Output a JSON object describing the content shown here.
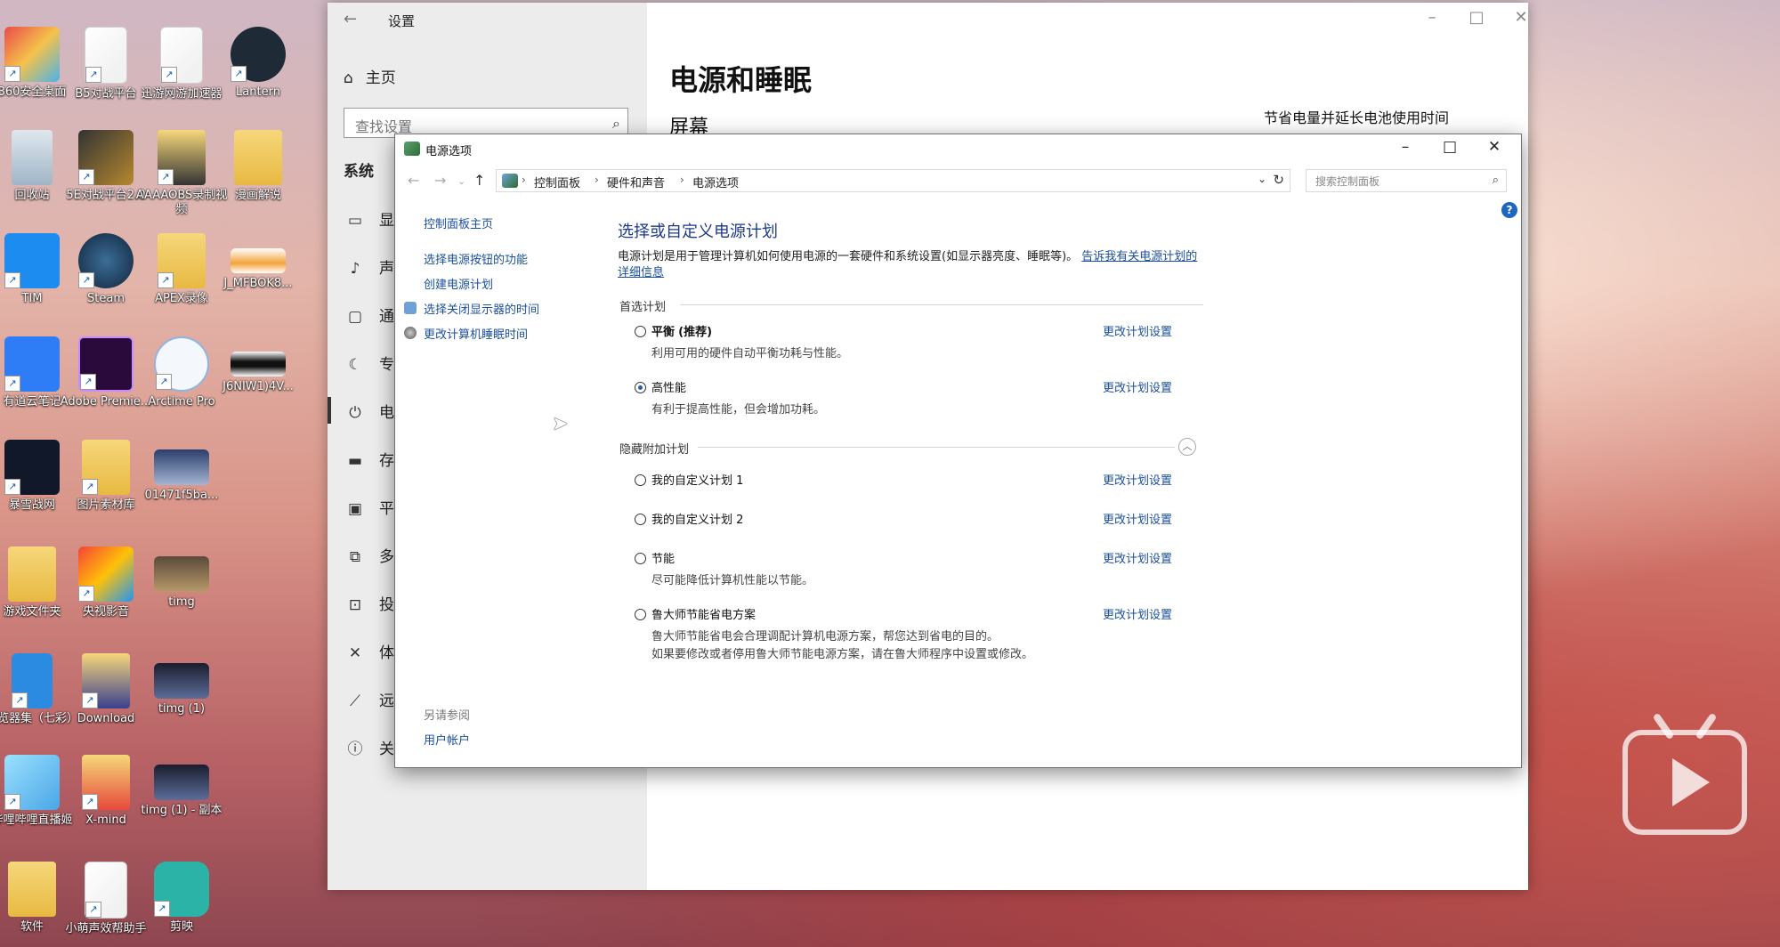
{
  "desktop": {
    "icons": [
      {
        "label": "360安全桌面"
      },
      {
        "label": "B5对战平台"
      },
      {
        "label": "迅游网游加速器"
      },
      {
        "label": "Lantern"
      },
      {
        "label": "回收站"
      },
      {
        "label": "5E对战平台2.0"
      },
      {
        "label": "AAAAOBS录制视频"
      },
      {
        "label": "漫画解说"
      },
      {
        "label": "TIM"
      },
      {
        "label": "Steam"
      },
      {
        "label": "APEX录像"
      },
      {
        "label": "J_MFBOK8..."
      },
      {
        "label": "有道云笔记"
      },
      {
        "label": "Adobe Premie..."
      },
      {
        "label": "Arctime Pro"
      },
      {
        "label": "J6NIW1)4V..."
      },
      {
        "label": "暴雪战网"
      },
      {
        "label": "图片素材库"
      },
      {
        "label": "01471f5ba..."
      },
      {
        "label": "游戏文件夹"
      },
      {
        "label": "央视影音"
      },
      {
        "label": "timg"
      },
      {
        "label": "浏览器集（七彩）"
      },
      {
        "label": "Download"
      },
      {
        "label": "timg (1)"
      },
      {
        "label": "哔哩哔哩直播姬"
      },
      {
        "label": "X-mind"
      },
      {
        "label": "timg (1) - 副本"
      },
      {
        "label": "软件"
      },
      {
        "label": "小萌声效帮助手"
      },
      {
        "label": "剪映"
      }
    ]
  },
  "settings": {
    "title": "设置",
    "home": "主页",
    "search_placeholder": "查找设置",
    "section": "系统",
    "side_items": [
      "显示",
      "声音",
      "通知",
      "专注",
      "电源",
      "存储",
      "平板",
      "多任务",
      "投影",
      "体验",
      "远程",
      "关于"
    ],
    "main_title": "电源和睡眠",
    "sub_title": "屏幕",
    "right_note": "节省电量并延长电池使用时间"
  },
  "power": {
    "title": "电源选项",
    "breadcrumb": [
      "控制面板",
      "硬件和声音",
      "电源选项"
    ],
    "search_placeholder": "搜索控制面板",
    "help": "?",
    "left_links": [
      "控制面板主页",
      "选择电源按钮的功能",
      "创建电源计划",
      "选择关闭显示器的时间",
      "更改计算机睡眠时间"
    ],
    "see_also_label": "另请参阅",
    "see_also_link": "用户帐户",
    "heading": "选择或自定义电源计划",
    "desc": "电源计划是用于管理计算机如何使用电源的一套硬件和系统设置(如显示器亮度、睡眠等)。",
    "desc_link": "告诉我有关电源计划的详细信息",
    "preferred_label": "首选计划",
    "hidden_label": "隐藏附加计划",
    "change_label": "更改计划设置",
    "plans": [
      {
        "name": "平衡",
        "suffix": "(推荐)",
        "desc": "利用可用的硬件自动平衡功耗与性能。",
        "selected": false
      },
      {
        "name": "高性能",
        "suffix": "",
        "desc": "有利于提高性能，但会增加功耗。",
        "selected": true
      }
    ],
    "hidden_plans": [
      {
        "name": "我的自定义计划 1",
        "desc": "",
        "desc2": "",
        "selected": false
      },
      {
        "name": "我的自定义计划 2",
        "desc": "",
        "desc2": "",
        "selected": false
      },
      {
        "name": "节能",
        "desc": "尽可能降低计算机性能以节能。",
        "desc2": "",
        "selected": false
      },
      {
        "name": "鲁大师节能省电方案",
        "desc": "鲁大师节能省电会合理调配计算机电源方案，帮您达到省电的目的。",
        "desc2": "如果要修改或者停用鲁大师节能电源方案，请在鲁大师程序中设置或修改。",
        "selected": false
      }
    ]
  }
}
